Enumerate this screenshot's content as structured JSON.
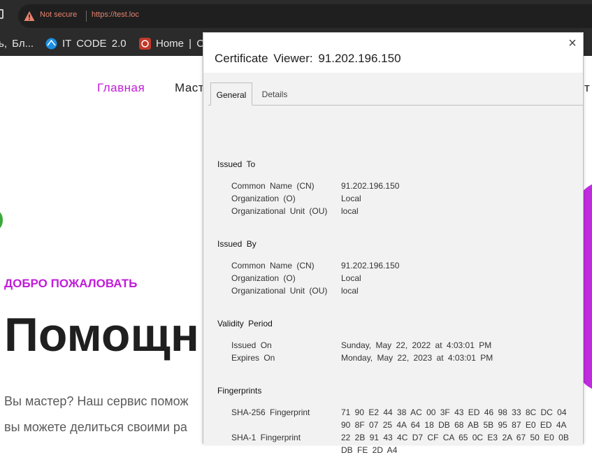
{
  "browser": {
    "security_text": "Not secure",
    "url": "https://test.loc",
    "bookmarks": [
      {
        "label": "ь, Бл..."
      },
      {
        "label": "IT CODE 2.0",
        "icon": "globe-icon",
        "color": "#1a8fe3"
      },
      {
        "label": "Home | C",
        "icon": "site-favicon",
        "color": "#c0392b"
      }
    ]
  },
  "page": {
    "nav_home": "Главная",
    "nav_masters": "Маст",
    "nav_right": "т",
    "welcome": "ДОБРО ПОЖАЛОВАТЬ",
    "hero_title": "Помощн",
    "hero_text_1": "Вы мастер? Наш сервис помож",
    "hero_text_2": "вы можете делиться своими ра",
    "accent_color": "#c11cd9"
  },
  "dialog": {
    "title": "Certificate Viewer: 91.202.196.150",
    "close_glyph": "×",
    "tabs": {
      "general": "General",
      "details": "Details"
    },
    "issued_to": {
      "title": "Issued To",
      "cn_label": "Common Name (CN)",
      "cn_value": "91.202.196.150",
      "o_label": "Organization (O)",
      "o_value": "Local",
      "ou_label": "Organizational Unit (OU)",
      "ou_value": "local"
    },
    "issued_by": {
      "title": "Issued By",
      "cn_label": "Common Name (CN)",
      "cn_value": "91.202.196.150",
      "o_label": "Organization (O)",
      "o_value": "Local",
      "ou_label": "Organizational Unit (OU)",
      "ou_value": "local"
    },
    "validity": {
      "title": "Validity Period",
      "issued_on_label": "Issued On",
      "issued_on_value": "Sunday, May 22, 2022 at 4:03:01 PM",
      "expires_on_label": "Expires On",
      "expires_on_value": "Monday, May 22, 2023 at 4:03:01 PM"
    },
    "fingerprints": {
      "title": "Fingerprints",
      "sha256_label": "SHA-256 Fingerprint",
      "sha256_line1": "71 90 E2 44 38 AC 00 3F 43 ED 46 98 33 8C DC 04",
      "sha256_line2": "90 8F 07 25 4A 64 18 DB 68 AB 5B 95 87 E0 ED 4A",
      "sha1_label": "SHA-1 Fingerprint",
      "sha1_line1": "22 2B 91 43 4C D7 CF CA 65 0C E3 2A 67 50 E0 0B",
      "sha1_line2": "DB FE 2D A4"
    }
  }
}
